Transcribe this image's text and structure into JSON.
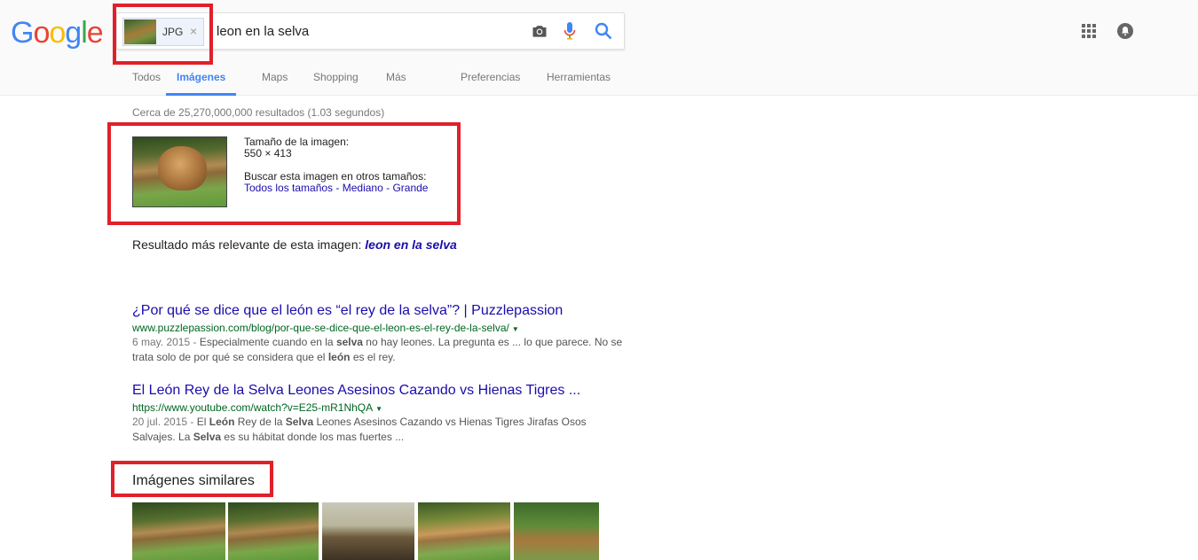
{
  "logo": {
    "text": "Google"
  },
  "search": {
    "chip_label": "JPG",
    "chip_close": "×",
    "query": "leon en la selva"
  },
  "tabs": [
    {
      "label": "Todos",
      "active": false
    },
    {
      "label": "Imágenes",
      "active": true
    },
    {
      "label": "Maps",
      "active": false
    },
    {
      "label": "Shopping",
      "active": false
    },
    {
      "label": "Más",
      "active": false
    },
    {
      "label": "Preferencias",
      "active": false
    },
    {
      "label": "Herramientas",
      "active": false
    }
  ],
  "stats": "Cerca de 25,270,000,000 resultados (1.03 segundos)",
  "image_info": {
    "size_label": "Tamaño de la imagen:",
    "size_value": "550 × 413",
    "other_sizes_label": "Buscar esta imagen en otros tamaños:",
    "links": [
      "Todos los tamaños",
      "Mediano",
      "Grande"
    ],
    "separator": " - "
  },
  "relevant": {
    "label": "Resultado más relevante de esta imagen:",
    "query": "leon en la selva"
  },
  "results": [
    {
      "title": "¿Por qué se dice que el león es “el rey de la selva”? | Puzzlepassion",
      "url": "www.puzzlepassion.com/blog/por-que-se-dice-que-el-leon-es-el-rey-de-la-selva/",
      "date": "6 may. 2015 - ",
      "snippet_parts": [
        "Especialmente cuando en la ",
        "selva",
        " no hay leones. La pregunta es ... lo que parece. No se trata solo de por qué se considera que el ",
        "león",
        " es el rey."
      ]
    },
    {
      "title": "El León Rey de la Selva Leones Asesinos Cazando vs Hienas Tigres ...",
      "url": "https://www.youtube.com/watch?v=E25-mR1NhQA",
      "date": "20 jul. 2015 - ",
      "snippet_parts": [
        "El ",
        "León",
        " Rey de la ",
        "Selva",
        " Leones Asesinos Cazando vs Hienas Tigres Jirafas Osos Salvajes. La ",
        "Selva",
        " es su hábitat donde los mas fuertes ..."
      ]
    }
  ],
  "similar": {
    "heading": "Imágenes similares",
    "images": [
      {
        "name": "similar-lion-1"
      },
      {
        "name": "similar-lion-2"
      },
      {
        "name": "similar-antelope"
      },
      {
        "name": "similar-lion-3"
      },
      {
        "name": "similar-lion-resting"
      }
    ]
  },
  "colors": {
    "accent": "#4285f4",
    "link": "#1a0dab",
    "url": "#006621",
    "highlight_box": "#e0202a"
  },
  "icons": [
    "camera-icon",
    "mic-icon",
    "search-icon",
    "apps-grid-icon",
    "notifications-icon",
    "dropdown-arrow-icon"
  ]
}
